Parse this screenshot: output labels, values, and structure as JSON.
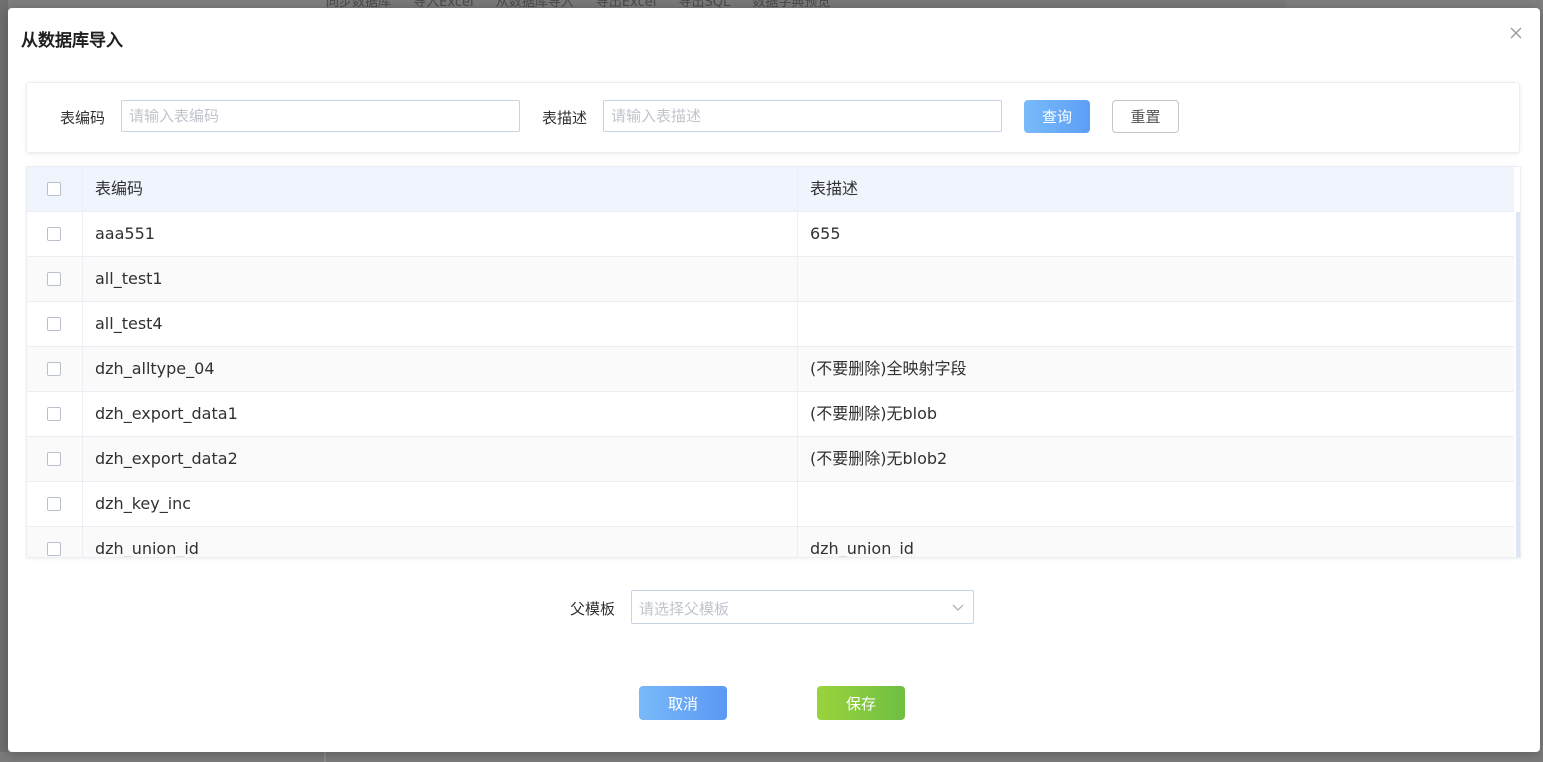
{
  "background": {
    "toolbar_items": [
      "同步数据库",
      "导入Excel",
      "从数据库导入",
      "导出Excel",
      "导出SQL",
      "数据字典预览"
    ]
  },
  "dialog": {
    "title": "从数据库导入",
    "close_icon": "close-icon"
  },
  "search": {
    "code_label": "表编码",
    "code_placeholder": "请输入表编码",
    "desc_label": "表描述",
    "desc_placeholder": "请输入表描述",
    "query_label": "查询",
    "reset_label": "重置"
  },
  "table": {
    "headers": [
      "表编码",
      "表描述"
    ],
    "rows": [
      {
        "code": "aaa551",
        "desc": "655"
      },
      {
        "code": "all_test1",
        "desc": ""
      },
      {
        "code": "all_test4",
        "desc": ""
      },
      {
        "code": "dzh_alltype_04",
        "desc": "(不要删除)全映射字段"
      },
      {
        "code": "dzh_export_data1",
        "desc": "(不要删除)无blob"
      },
      {
        "code": "dzh_export_data2",
        "desc": "(不要删除)无blob2"
      },
      {
        "code": "dzh_key_inc",
        "desc": ""
      },
      {
        "code": "dzh_union_id",
        "desc": "dzh_union_id"
      }
    ]
  },
  "parent": {
    "label": "父模板",
    "placeholder": "请选择父模板"
  },
  "footer": {
    "cancel_label": "取消",
    "save_label": "保存"
  },
  "colors": {
    "primary": "#5d9ef7",
    "success": "#6fbf43",
    "header_bg": "#f0f4fc"
  }
}
